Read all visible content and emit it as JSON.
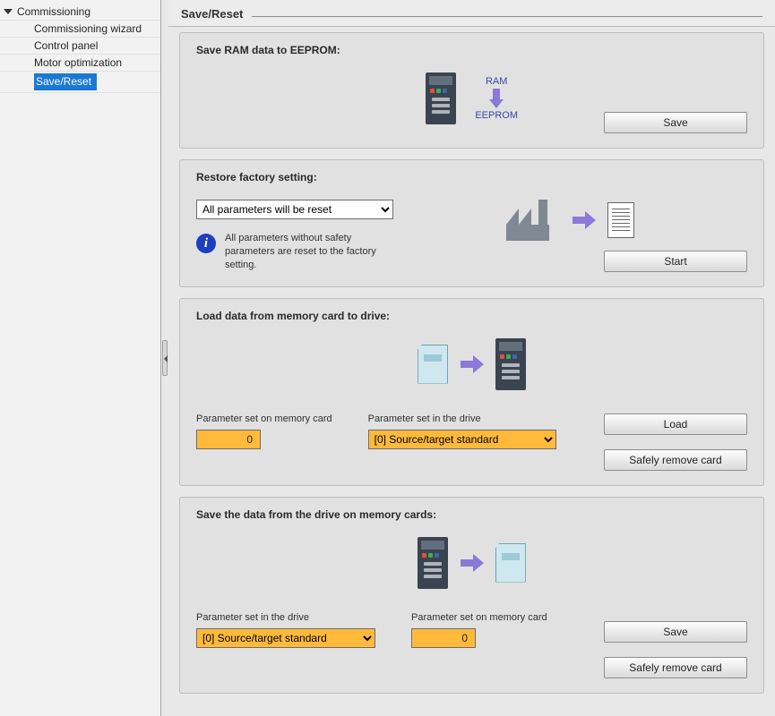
{
  "sidebar": {
    "parent_label": "Commissioning",
    "items": [
      {
        "label": "Commissioning wizard"
      },
      {
        "label": "Control panel"
      },
      {
        "label": "Motor optimization"
      },
      {
        "label": "Save/Reset",
        "selected": true
      }
    ]
  },
  "page_title": "Save/Reset",
  "save_ram": {
    "heading": "Save RAM data to EEPROM:",
    "top_label": "RAM",
    "bottom_label": "EEPROM",
    "save_btn": "Save"
  },
  "restore": {
    "heading": "Restore factory setting:",
    "select_value": "All parameters will be reset",
    "note": "All parameters without safety parameters are reset to the factory setting.",
    "start_btn": "Start"
  },
  "load_card": {
    "heading": "Load data from memory card to drive:",
    "param_on_card_label": "Parameter set on memory card",
    "param_on_card_value": "0",
    "param_in_drive_label": "Parameter set in the drive",
    "param_in_drive_value": "[0] Source/target standard",
    "load_btn": "Load",
    "remove_btn": "Safely remove card"
  },
  "save_card": {
    "heading": "Save the data from the drive on memory cards:",
    "param_in_drive_label": "Parameter set in the drive",
    "param_in_drive_value": "[0] Source/target standard",
    "param_on_card_label": "Parameter set on memory card",
    "param_on_card_value": "0",
    "save_btn": "Save",
    "remove_btn": "Safely remove card"
  }
}
